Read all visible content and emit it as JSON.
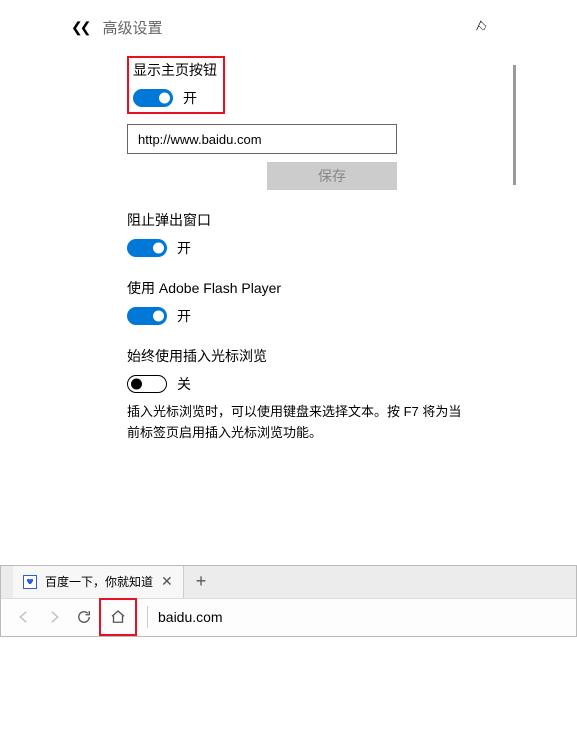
{
  "settings": {
    "title": "高级设置",
    "homeButton": {
      "label": "显示主页按钮",
      "state": "开"
    },
    "urlValue": "http://www.baidu.com",
    "saveLabel": "保存",
    "blockPopups": {
      "label": "阻止弹出窗口",
      "state": "开"
    },
    "flash": {
      "label": "使用 Adobe Flash Player",
      "state": "开"
    },
    "caret": {
      "label": "始终使用插入光标浏览",
      "state": "关",
      "desc": "插入光标浏览时，可以使用键盘来选择文本。按 F7 将为当前标签页启用插入光标浏览功能。"
    }
  },
  "browser": {
    "tabTitle": "百度一下，你就知道",
    "address": "baidu.com"
  }
}
